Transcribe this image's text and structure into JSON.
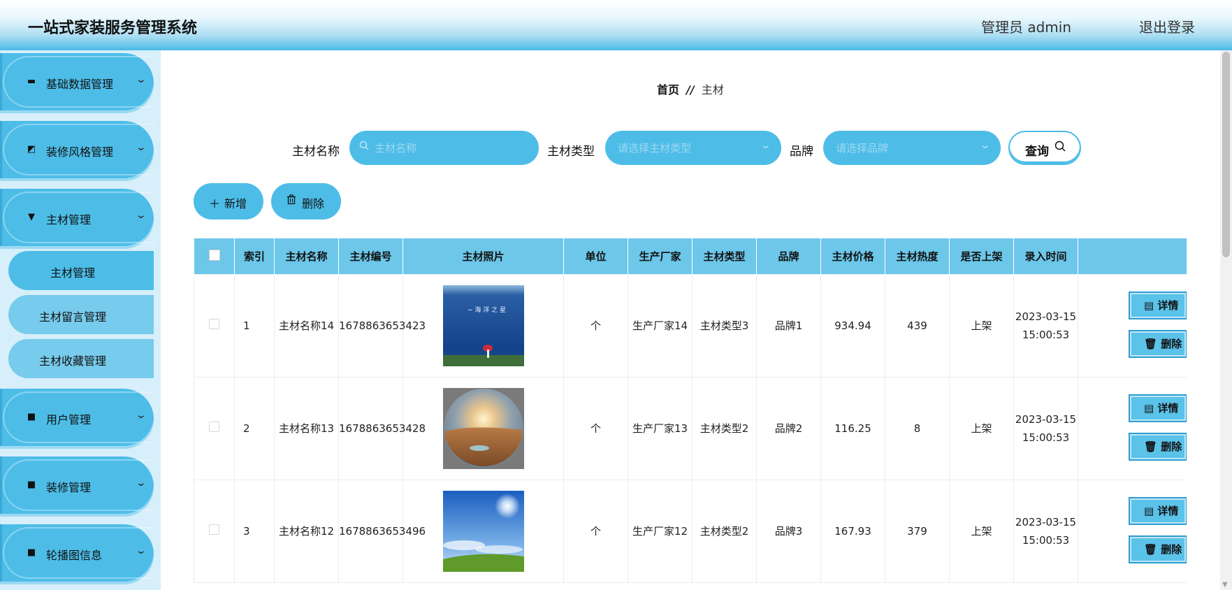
{
  "header": {
    "title": "一站式家装服务管理系统",
    "user": "管理员 admin",
    "logout": "退出登录"
  },
  "sidebar": {
    "menus": [
      {
        "label": "基础数据管理",
        "icon": "monitor-icon"
      },
      {
        "label": "装修风格管理",
        "icon": "chart-icon"
      },
      {
        "label": "主材管理",
        "icon": "brush-icon"
      },
      {
        "label": "用户管理",
        "icon": "grid-icon"
      },
      {
        "label": "装修管理",
        "icon": "grid-icon"
      },
      {
        "label": "轮播图信息",
        "icon": "grid-icon"
      }
    ],
    "submenus": [
      "主材管理",
      "主材留言管理",
      "主材收藏管理"
    ],
    "active_submenu": "主材管理"
  },
  "breadcrumb": {
    "home": "首页",
    "separator": "//",
    "current": "主材"
  },
  "search": {
    "name_label": "主材名称",
    "name_placeholder": "主材名称",
    "type_label": "主材类型",
    "type_placeholder": "请选择主材类型",
    "brand_label": "品牌",
    "brand_placeholder": "请选择品牌",
    "query_button": "查询"
  },
  "actions": {
    "add": "新增",
    "delete": "删除"
  },
  "table": {
    "headers": [
      "索引",
      "主材名称",
      "主材编号",
      "主材照片",
      "单位",
      "生产厂家",
      "主材类型",
      "品牌",
      "主材价格",
      "主材热度",
      "是否上架",
      "录入时间"
    ],
    "detail_label": "详情",
    "delete_label": "删除",
    "rows": [
      {
        "index": "1",
        "name": "主材名称14",
        "code": "1678863653423",
        "photo": "sea-photo",
        "unit": "个",
        "maker": "生产厂家14",
        "type": "主材类型3",
        "brand": "品牌1",
        "price": "934.94",
        "heat": "439",
        "listed": "上架",
        "time": "2023-03-15 15:00:53"
      },
      {
        "index": "2",
        "name": "主材名称13",
        "code": "1678863653428",
        "photo": "desert-photo",
        "unit": "个",
        "maker": "生产厂家13",
        "type": "主材类型2",
        "brand": "品牌2",
        "price": "116.25",
        "heat": "8",
        "listed": "上架",
        "time": "2023-03-15 15:00:53"
      },
      {
        "index": "3",
        "name": "主材名称12",
        "code": "1678863653496",
        "photo": "sky-photo",
        "unit": "个",
        "maker": "生产厂家12",
        "type": "主材类型2",
        "brand": "品牌3",
        "price": "167.93",
        "heat": "379",
        "listed": "上架",
        "time": "2023-03-15 15:00:53"
      }
    ]
  },
  "colors": {
    "primary": "#4dbde8",
    "sidebar_bg": "#d6effa",
    "table_header": "#6cc7e9"
  }
}
